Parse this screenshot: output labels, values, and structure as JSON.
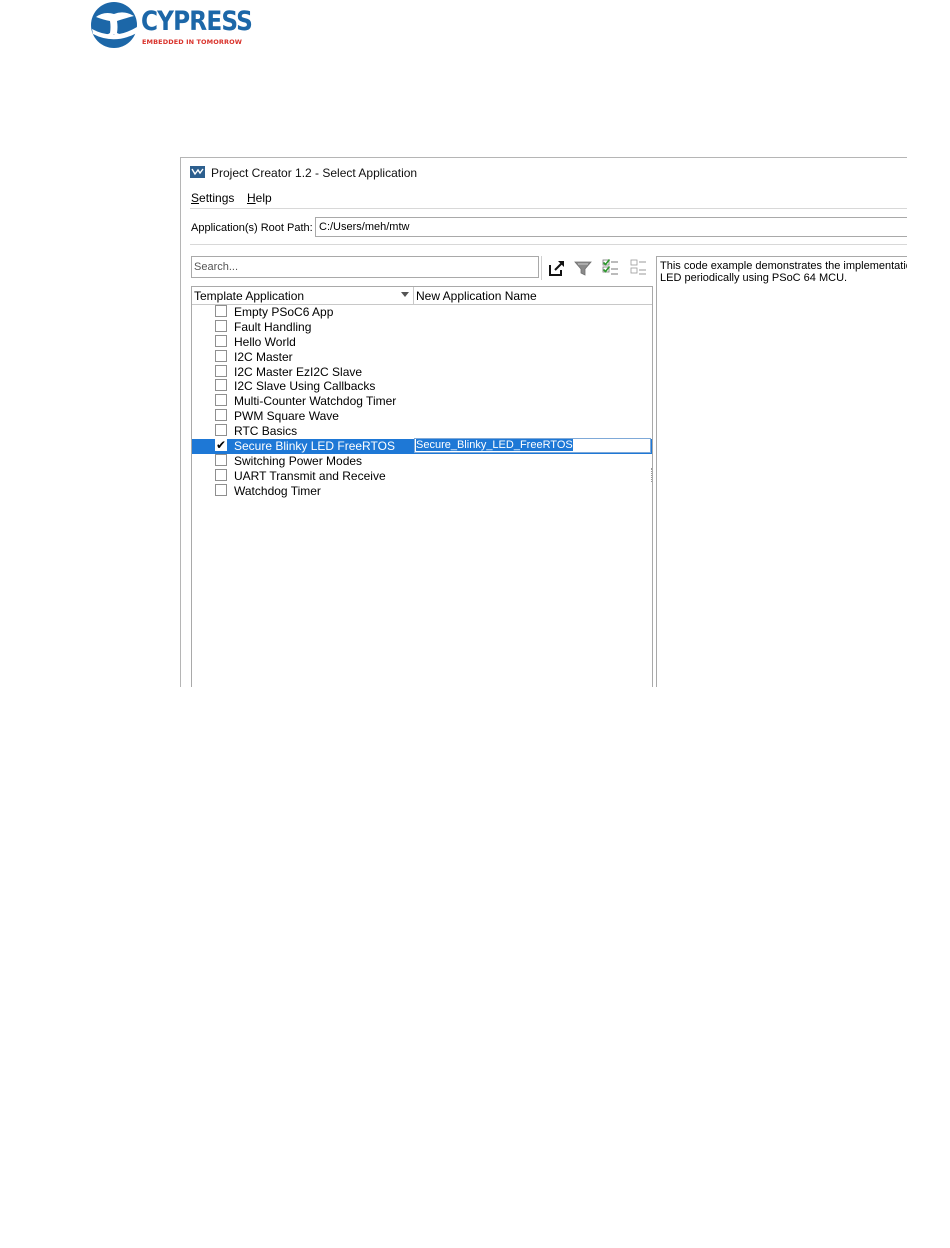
{
  "logo": {
    "brand": "CYPRESS",
    "tagline": "EMBEDDED IN TOMORROW"
  },
  "window": {
    "title": "Project Creator 1.2 - Select Application",
    "menu": [
      "Settings",
      "Help"
    ],
    "root_path": {
      "label": "Application(s) Root Path:",
      "value": "C:/Users/meh/mtw"
    },
    "search": {
      "placeholder": "Search..."
    },
    "toolbar": {
      "icons": [
        "import-icon",
        "filter-icon",
        "check-all-icon",
        "uncheck-all-icon"
      ]
    },
    "tree": {
      "columns": [
        "Template Application",
        "New Application Name"
      ],
      "rows": [
        {
          "label": "Empty PSoC6 App",
          "checked": false
        },
        {
          "label": "Fault Handling",
          "checked": false
        },
        {
          "label": "Hello World",
          "checked": false
        },
        {
          "label": "I2C Master",
          "checked": false
        },
        {
          "label": "I2C Master EzI2C Slave",
          "checked": false
        },
        {
          "label": "I2C Slave Using Callbacks",
          "checked": false
        },
        {
          "label": "Multi-Counter Watchdog Timer",
          "checked": false
        },
        {
          "label": "PWM Square Wave",
          "checked": false
        },
        {
          "label": "RTC Basics",
          "checked": false
        },
        {
          "label": "Secure Blinky LED FreeRTOS",
          "checked": true,
          "new_name": "Secure_Blinky_LED_FreeRTOS",
          "selected": true
        },
        {
          "label": "Switching Power Modes",
          "checked": false
        },
        {
          "label": "UART Transmit and Receive",
          "checked": false
        },
        {
          "label": "Watchdog Timer",
          "checked": false
        }
      ]
    },
    "description": {
      "line1": "This code example demonstrates the implementation",
      "line2": "LED periodically using PSoC 64 MCU."
    }
  },
  "colors": {
    "selection": "#1e78d6",
    "brand_blue": "#1c67a8",
    "brand_red": "#d9322b"
  }
}
